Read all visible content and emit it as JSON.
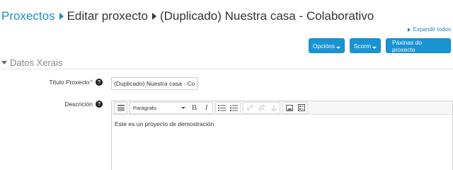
{
  "breadcrumb": {
    "root": "Proxectos",
    "middle": "Editar proxecto",
    "current": "(Duplicado) Nuestra casa - Colaborativo"
  },
  "expand_all": "Expandir todos",
  "buttons": {
    "options": "Opcións",
    "scorm": "Scorm",
    "pages": "Páxinas do proxecto"
  },
  "section": {
    "title": "Datos Xerais"
  },
  "form": {
    "title_label": "Título Proxecto",
    "title_required": "*",
    "title_value": "(Duplicado) Nuestra casa - Colaborativo",
    "description_label": "Descrición",
    "help_glyph": "?"
  },
  "editor": {
    "format_label": "Parágrafo",
    "content": "Este es un proyecto de demostración"
  },
  "colors": {
    "link": "#1f8cc6",
    "button": "#1a93d3",
    "required": "#d9534f"
  }
}
